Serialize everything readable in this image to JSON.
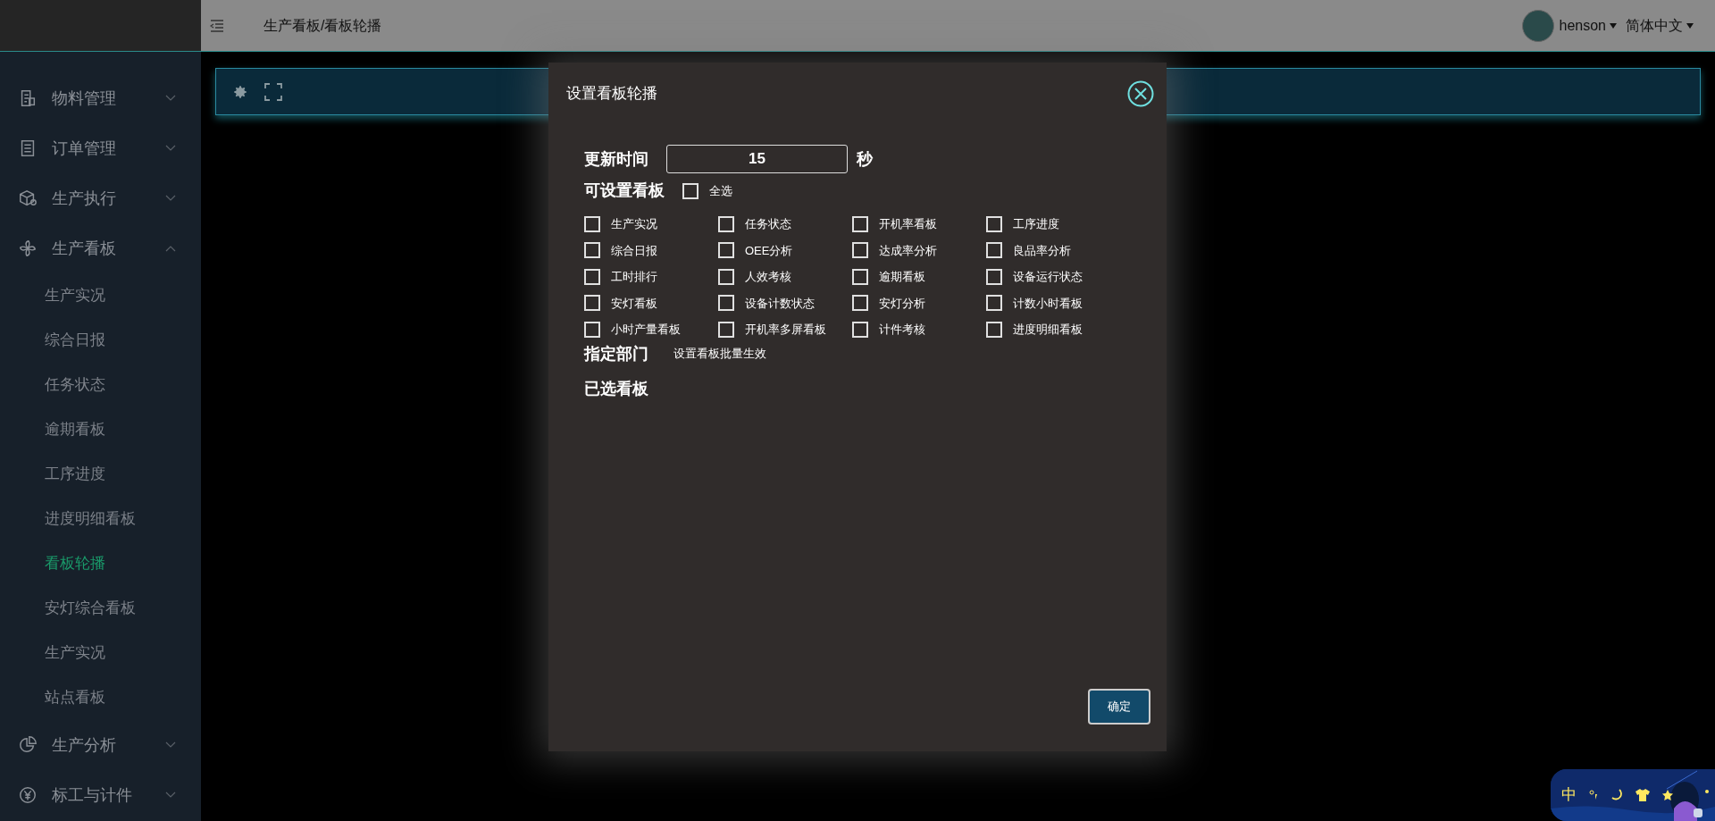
{
  "sidebar": {
    "items": [
      {
        "label": "物料管理",
        "expanded": false
      },
      {
        "label": "订单管理",
        "expanded": false
      },
      {
        "label": "生产执行",
        "expanded": false
      },
      {
        "label": "生产看板",
        "expanded": true,
        "children": [
          {
            "label": "生产实况",
            "selected": false
          },
          {
            "label": "综合日报",
            "selected": false
          },
          {
            "label": "任务状态",
            "selected": false
          },
          {
            "label": "逾期看板",
            "selected": false
          },
          {
            "label": "工序进度",
            "selected": false
          },
          {
            "label": "进度明细看板",
            "selected": false
          },
          {
            "label": "看板轮播",
            "selected": true
          },
          {
            "label": "安灯综合看板",
            "selected": false
          },
          {
            "label": "生产实况",
            "selected": false
          },
          {
            "label": "站点看板",
            "selected": false
          }
        ]
      },
      {
        "label": "生产分析",
        "expanded": false
      },
      {
        "label": "标工与计件",
        "expanded": false
      }
    ]
  },
  "header": {
    "breadcrumb": "生产看板/看板轮播",
    "user": "henson",
    "language": "简体中文"
  },
  "dialog": {
    "title": "设置看板轮播",
    "update_time": {
      "label": "更新时间",
      "value": "15",
      "unit": "秒"
    },
    "boards": {
      "label": "可设置看板",
      "select_all": {
        "label": "全选",
        "checked": false
      },
      "options": [
        {
          "label": "生产实况",
          "checked": false
        },
        {
          "label": "任务状态",
          "checked": false
        },
        {
          "label": "开机率看板",
          "checked": false
        },
        {
          "label": "工序进度",
          "checked": false
        },
        {
          "label": "综合日报",
          "checked": false
        },
        {
          "label": "OEE分析",
          "checked": false
        },
        {
          "label": "达成率分析",
          "checked": false
        },
        {
          "label": "良品率分析",
          "checked": false
        },
        {
          "label": "工时排行",
          "checked": false
        },
        {
          "label": "人效考核",
          "checked": false
        },
        {
          "label": "逾期看板",
          "checked": false
        },
        {
          "label": "设备运行状态",
          "checked": false
        },
        {
          "label": "安灯看板",
          "checked": false
        },
        {
          "label": "设备计数状态",
          "checked": false
        },
        {
          "label": "安灯分析",
          "checked": false
        },
        {
          "label": "计数小时看板",
          "checked": false
        },
        {
          "label": "小时产量看板",
          "checked": false
        },
        {
          "label": "开机率多屏看板",
          "checked": false
        },
        {
          "label": "计件考核",
          "checked": false
        },
        {
          "label": "进度明细看板",
          "checked": false
        }
      ]
    },
    "department": {
      "label": "指定部门",
      "note": "设置看板批量生效"
    },
    "selected_boards": {
      "label": "已选看板"
    },
    "confirm": "确定"
  },
  "ime": {
    "mode": "中"
  }
}
